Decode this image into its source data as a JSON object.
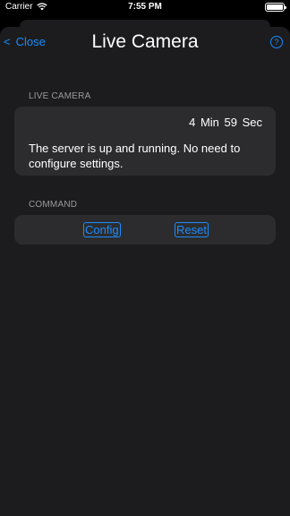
{
  "status_bar": {
    "carrier": "Carrier",
    "time": "7:55 PM"
  },
  "nav": {
    "back_chevron": "<",
    "close_label": "Close",
    "title": "Live Camera",
    "help_label": "?"
  },
  "live_camera": {
    "header": "LIVE CAMERA",
    "timer": "4  Min  59  Sec",
    "message": "The server is up and running. No need to configure settings."
  },
  "command": {
    "header": "COMMAND",
    "config_label": "Config",
    "reset_label": "Reset"
  },
  "colors": {
    "accent": "#1a8cff",
    "sheet_bg": "#1c1c1e",
    "card_bg": "#2c2c2e",
    "secondary_text": "#9a9aa0"
  }
}
